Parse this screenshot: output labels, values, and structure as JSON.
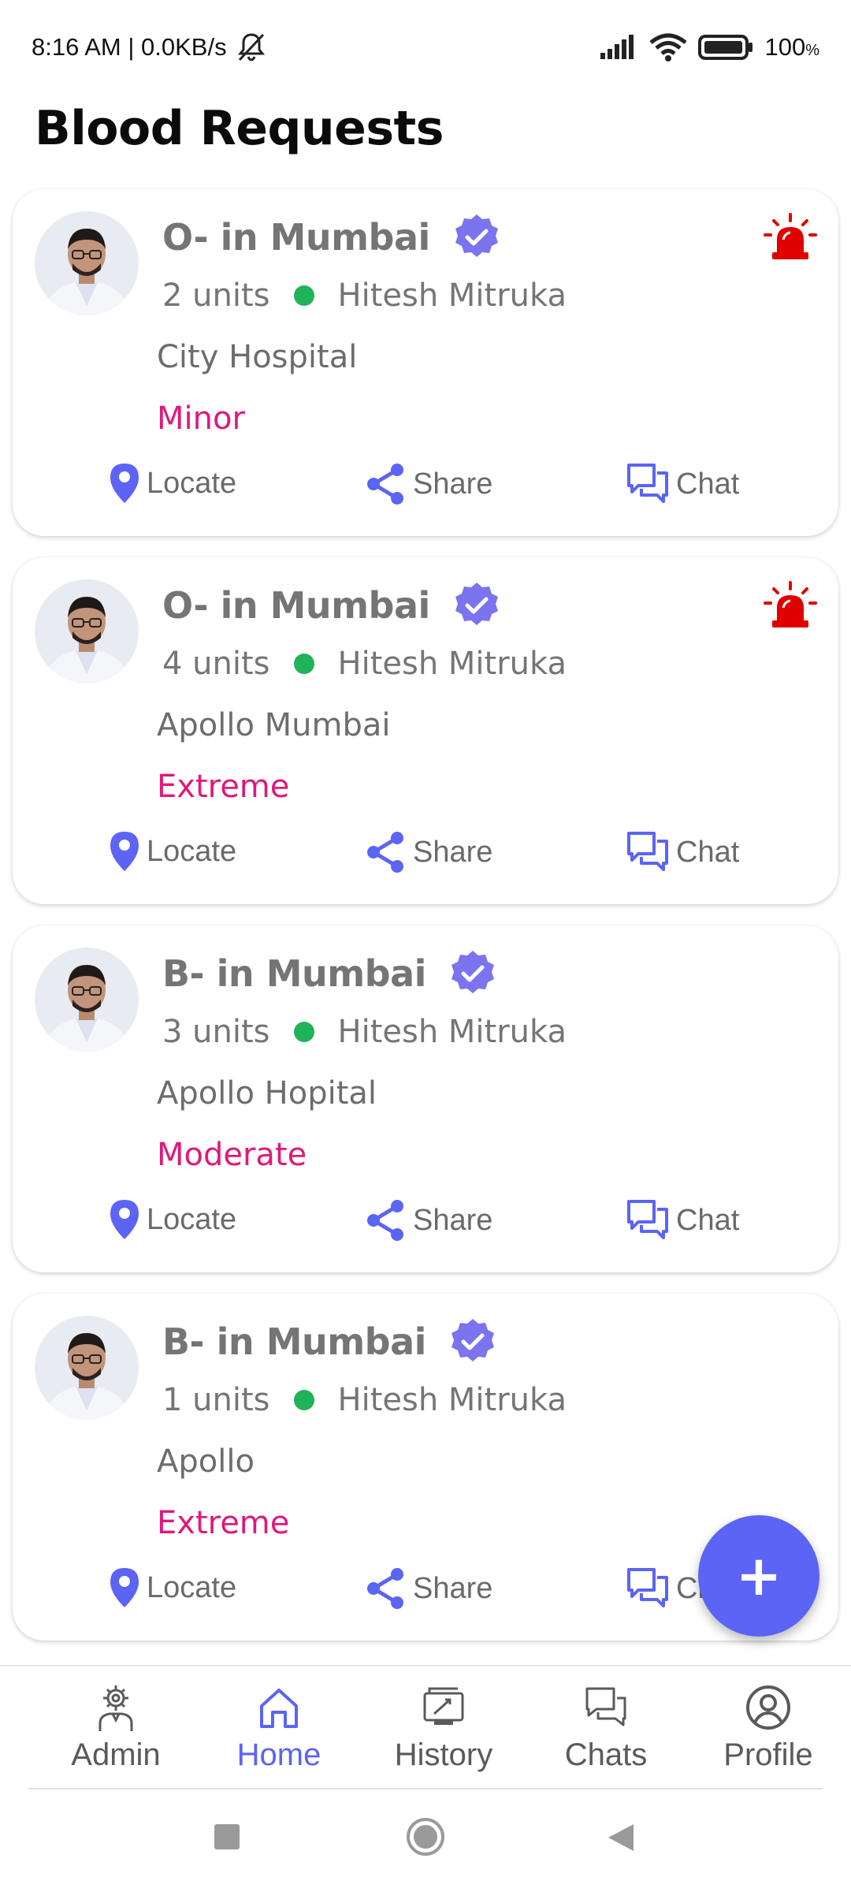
{
  "status_bar": {
    "time_speed": "8:16 AM | 0.0KB/s",
    "battery": "100",
    "battery_unit": "%"
  },
  "page": {
    "title": "Blood Requests"
  },
  "colors": {
    "accent": "#5b64f5",
    "severity": "#e0197a",
    "online": "#1fb35a",
    "alarm": "#e00000"
  },
  "requests": [
    {
      "title": "O- in Mumbai",
      "units": "2 units",
      "requester": "Hitesh Mitruka",
      "hospital": "City Hospital",
      "severity": "Minor",
      "emergency": true
    },
    {
      "title": "O- in Mumbai",
      "units": "4 units",
      "requester": "Hitesh Mitruka",
      "hospital": "Apollo Mumbai",
      "severity": "Extreme",
      "emergency": true
    },
    {
      "title": "B- in Mumbai",
      "units": "3 units",
      "requester": "Hitesh Mitruka",
      "hospital": "Apollo Hopital",
      "severity": "Moderate",
      "emergency": false
    },
    {
      "title": "B- in Mumbai",
      "units": "1 units",
      "requester": "Hitesh Mitruka",
      "hospital": "Apollo",
      "severity": "Extreme",
      "emergency": false
    }
  ],
  "actions": {
    "locate": "Locate",
    "share": "Share",
    "chat": "Chat"
  },
  "fab": {
    "label": "+"
  },
  "bottom_nav": {
    "items": [
      {
        "label": "Admin",
        "icon": "admin-gear-icon"
      },
      {
        "label": "Home",
        "icon": "home-icon"
      },
      {
        "label": "History",
        "icon": "history-icon"
      },
      {
        "label": "Chats",
        "icon": "chats-icon"
      },
      {
        "label": "Profile",
        "icon": "profile-icon"
      }
    ],
    "active": "Home"
  }
}
